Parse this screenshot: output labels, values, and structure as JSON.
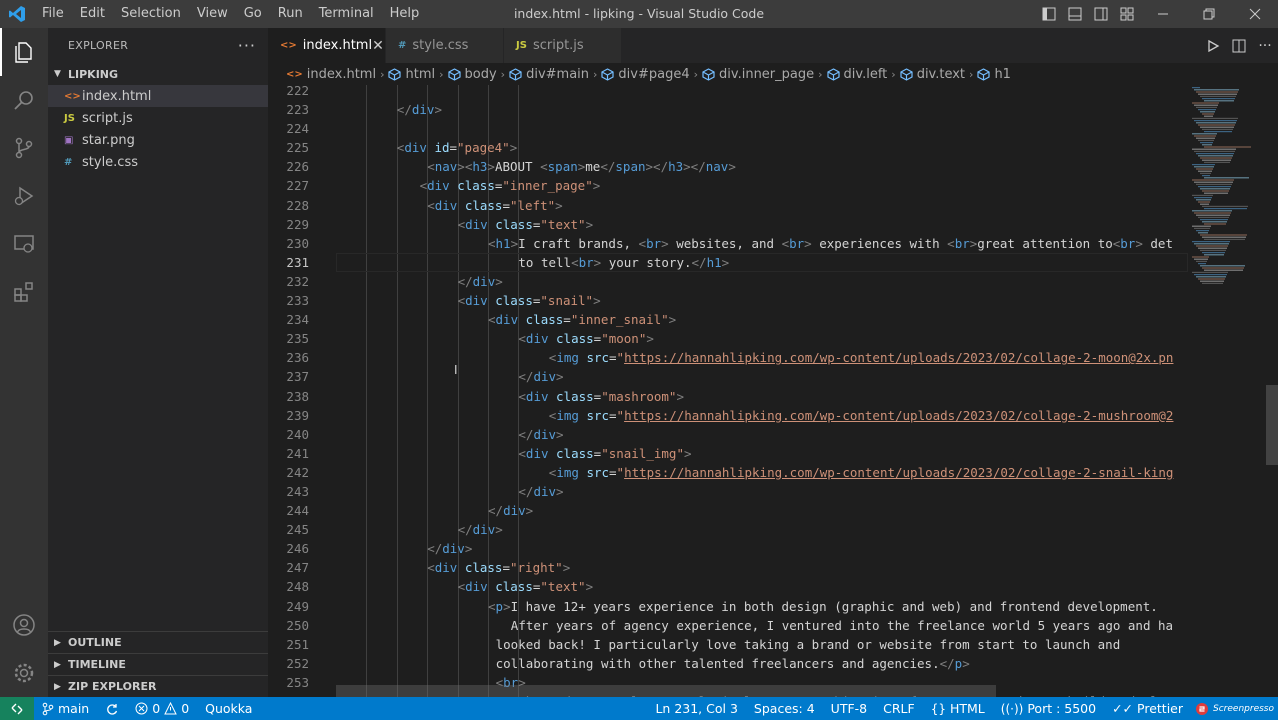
{
  "window": {
    "title": "index.html - lipking - Visual Studio Code",
    "menu": [
      "File",
      "Edit",
      "Selection",
      "View",
      "Go",
      "Run",
      "Terminal",
      "Help"
    ]
  },
  "sidebar": {
    "title": "EXPLORER",
    "folder": "LIPKING",
    "files": [
      {
        "name": "index.html",
        "icon_text": "<>",
        "color": "#e37933",
        "selected": true
      },
      {
        "name": "script.js",
        "icon_text": "JS",
        "color": "#cbcb41",
        "selected": false
      },
      {
        "name": "star.png",
        "icon_text": "▣",
        "color": "#a074c4",
        "selected": false
      },
      {
        "name": "style.css",
        "icon_text": "#",
        "color": "#519aba",
        "selected": false
      }
    ],
    "sections": [
      "OUTLINE",
      "TIMELINE",
      "ZIP EXPLORER"
    ]
  },
  "tabs": [
    {
      "name": "index.html",
      "icon_text": "<>",
      "color": "#e37933",
      "active": true
    },
    {
      "name": "style.css",
      "icon_text": "#",
      "color": "#519aba",
      "active": false
    },
    {
      "name": "script.js",
      "icon_text": "JS",
      "color": "#cbcb41",
      "active": false
    }
  ],
  "breadcrumb": [
    "index.html",
    "html",
    "body",
    "div#main",
    "div#page4",
    "div.inner_page",
    "div.left",
    "div.text",
    "h1"
  ],
  "editor": {
    "current_line": "231",
    "lines": [
      {
        "n": "222",
        "indent": 0,
        "parts": []
      },
      {
        "n": "223",
        "indent": 8,
        "parts": [
          {
            "t": "tb",
            "v": "</"
          },
          {
            "t": "tg",
            "v": "div"
          },
          {
            "t": "tb",
            "v": ">"
          }
        ]
      },
      {
        "n": "224",
        "indent": 0,
        "parts": []
      },
      {
        "n": "225",
        "indent": 8,
        "parts": [
          {
            "t": "tb",
            "v": "<"
          },
          {
            "t": "tg",
            "v": "div"
          },
          {
            "t": "tx",
            "v": " "
          },
          {
            "t": "at",
            "v": "id"
          },
          {
            "t": "tx",
            "v": "="
          },
          {
            "t": "sv",
            "v": "\"page4\""
          },
          {
            "t": "tb",
            "v": ">"
          }
        ]
      },
      {
        "n": "226",
        "indent": 12,
        "parts": [
          {
            "t": "tb",
            "v": "<"
          },
          {
            "t": "tg",
            "v": "nav"
          },
          {
            "t": "tb",
            "v": "><"
          },
          {
            "t": "tg",
            "v": "h3"
          },
          {
            "t": "tb",
            "v": ">"
          },
          {
            "t": "tx",
            "v": "ABOUT "
          },
          {
            "t": "tb",
            "v": "<"
          },
          {
            "t": "tg",
            "v": "span"
          },
          {
            "t": "tb",
            "v": ">"
          },
          {
            "t": "tx",
            "v": "me"
          },
          {
            "t": "tb",
            "v": "</"
          },
          {
            "t": "tg",
            "v": "span"
          },
          {
            "t": "tb",
            "v": "></"
          },
          {
            "t": "tg",
            "v": "h3"
          },
          {
            "t": "tb",
            "v": "></"
          },
          {
            "t": "tg",
            "v": "nav"
          },
          {
            "t": "tb",
            "v": ">"
          }
        ]
      },
      {
        "n": "227",
        "indent": 11,
        "parts": [
          {
            "t": "tb",
            "v": "<"
          },
          {
            "t": "tg",
            "v": "div"
          },
          {
            "t": "tx",
            "v": " "
          },
          {
            "t": "at",
            "v": "class"
          },
          {
            "t": "tx",
            "v": "="
          },
          {
            "t": "sv",
            "v": "\"inner_page\""
          },
          {
            "t": "tb",
            "v": ">"
          }
        ]
      },
      {
        "n": "228",
        "indent": 12,
        "parts": [
          {
            "t": "tb",
            "v": "<"
          },
          {
            "t": "tg",
            "v": "div"
          },
          {
            "t": "tx",
            "v": " "
          },
          {
            "t": "at",
            "v": "class"
          },
          {
            "t": "tx",
            "v": "="
          },
          {
            "t": "sv",
            "v": "\"left\""
          },
          {
            "t": "tb",
            "v": ">"
          }
        ]
      },
      {
        "n": "229",
        "indent": 16,
        "parts": [
          {
            "t": "tb",
            "v": "<"
          },
          {
            "t": "tg",
            "v": "div"
          },
          {
            "t": "tx",
            "v": " "
          },
          {
            "t": "at",
            "v": "class"
          },
          {
            "t": "tx",
            "v": "="
          },
          {
            "t": "sv",
            "v": "\"text\""
          },
          {
            "t": "tb",
            "v": ">"
          }
        ]
      },
      {
        "n": "230",
        "indent": 20,
        "parts": [
          {
            "t": "tb",
            "v": "<"
          },
          {
            "t": "tg",
            "v": "h1"
          },
          {
            "t": "tb",
            "v": ">"
          },
          {
            "t": "tx",
            "v": "I craft brands, "
          },
          {
            "t": "tb",
            "v": "<"
          },
          {
            "t": "tg",
            "v": "br"
          },
          {
            "t": "tb",
            "v": ">"
          },
          {
            "t": "tx",
            "v": " websites, and "
          },
          {
            "t": "tb",
            "v": "<"
          },
          {
            "t": "tg",
            "v": "br"
          },
          {
            "t": "tb",
            "v": ">"
          },
          {
            "t": "tx",
            "v": " experiences with "
          },
          {
            "t": "tb",
            "v": "<"
          },
          {
            "t": "tg",
            "v": "br"
          },
          {
            "t": "tb",
            "v": ">"
          },
          {
            "t": "tx",
            "v": "great attention to"
          },
          {
            "t": "tb",
            "v": "<"
          },
          {
            "t": "tg",
            "v": "br"
          },
          {
            "t": "tb",
            "v": ">"
          },
          {
            "t": "tx",
            "v": " det"
          }
        ]
      },
      {
        "n": "231",
        "indent": 24,
        "parts": [
          {
            "t": "tx",
            "v": "to tell"
          },
          {
            "t": "tb",
            "v": "<"
          },
          {
            "t": "tg",
            "v": "br"
          },
          {
            "t": "tb",
            "v": ">"
          },
          {
            "t": "tx",
            "v": " your story."
          },
          {
            "t": "tb",
            "v": "</"
          },
          {
            "t": "tg",
            "v": "h1"
          },
          {
            "t": "tb",
            "v": ">"
          }
        ]
      },
      {
        "n": "232",
        "indent": 16,
        "parts": [
          {
            "t": "tb",
            "v": "</"
          },
          {
            "t": "tg",
            "v": "div"
          },
          {
            "t": "tb",
            "v": ">"
          }
        ]
      },
      {
        "n": "233",
        "indent": 16,
        "parts": [
          {
            "t": "tb",
            "v": "<"
          },
          {
            "t": "tg",
            "v": "div"
          },
          {
            "t": "tx",
            "v": " "
          },
          {
            "t": "at",
            "v": "class"
          },
          {
            "t": "tx",
            "v": "="
          },
          {
            "t": "sv",
            "v": "\"snail\""
          },
          {
            "t": "tb",
            "v": ">"
          }
        ]
      },
      {
        "n": "234",
        "indent": 20,
        "parts": [
          {
            "t": "tb",
            "v": "<"
          },
          {
            "t": "tg",
            "v": "div"
          },
          {
            "t": "tx",
            "v": " "
          },
          {
            "t": "at",
            "v": "class"
          },
          {
            "t": "tx",
            "v": "="
          },
          {
            "t": "sv",
            "v": "\"inner_snail\""
          },
          {
            "t": "tb",
            "v": ">"
          }
        ]
      },
      {
        "n": "235",
        "indent": 24,
        "parts": [
          {
            "t": "tb",
            "v": "<"
          },
          {
            "t": "tg",
            "v": "div"
          },
          {
            "t": "tx",
            "v": " "
          },
          {
            "t": "at",
            "v": "class"
          },
          {
            "t": "tx",
            "v": "="
          },
          {
            "t": "sv",
            "v": "\"moon\""
          },
          {
            "t": "tb",
            "v": ">"
          }
        ]
      },
      {
        "n": "236",
        "indent": 28,
        "parts": [
          {
            "t": "tb",
            "v": "<"
          },
          {
            "t": "tg",
            "v": "img"
          },
          {
            "t": "tx",
            "v": " "
          },
          {
            "t": "at",
            "v": "src"
          },
          {
            "t": "tx",
            "v": "="
          },
          {
            "t": "sv",
            "v": "\""
          },
          {
            "t": "url",
            "v": "https://hannahlipking.com/wp-content/uploads/2023/02/collage-2-moon@2x.pn"
          }
        ]
      },
      {
        "n": "237",
        "indent": 24,
        "parts": [
          {
            "t": "tb",
            "v": "</"
          },
          {
            "t": "tg",
            "v": "div"
          },
          {
            "t": "tb",
            "v": ">"
          }
        ]
      },
      {
        "n": "238",
        "indent": 24,
        "parts": [
          {
            "t": "tb",
            "v": "<"
          },
          {
            "t": "tg",
            "v": "div"
          },
          {
            "t": "tx",
            "v": " "
          },
          {
            "t": "at",
            "v": "class"
          },
          {
            "t": "tx",
            "v": "="
          },
          {
            "t": "sv",
            "v": "\"mashroom\""
          },
          {
            "t": "tb",
            "v": ">"
          }
        ]
      },
      {
        "n": "239",
        "indent": 28,
        "parts": [
          {
            "t": "tb",
            "v": "<"
          },
          {
            "t": "tg",
            "v": "img"
          },
          {
            "t": "tx",
            "v": " "
          },
          {
            "t": "at",
            "v": "src"
          },
          {
            "t": "tx",
            "v": "="
          },
          {
            "t": "sv",
            "v": "\""
          },
          {
            "t": "url",
            "v": "https://hannahlipking.com/wp-content/uploads/2023/02/collage-2-mushroom@2"
          }
        ]
      },
      {
        "n": "240",
        "indent": 24,
        "parts": [
          {
            "t": "tb",
            "v": "</"
          },
          {
            "t": "tg",
            "v": "div"
          },
          {
            "t": "tb",
            "v": ">"
          }
        ]
      },
      {
        "n": "241",
        "indent": 24,
        "parts": [
          {
            "t": "tb",
            "v": "<"
          },
          {
            "t": "tg",
            "v": "div"
          },
          {
            "t": "tx",
            "v": " "
          },
          {
            "t": "at",
            "v": "class"
          },
          {
            "t": "tx",
            "v": "="
          },
          {
            "t": "sv",
            "v": "\"snail_img\""
          },
          {
            "t": "tb",
            "v": ">"
          }
        ]
      },
      {
        "n": "242",
        "indent": 28,
        "parts": [
          {
            "t": "tb",
            "v": "<"
          },
          {
            "t": "tg",
            "v": "img"
          },
          {
            "t": "tx",
            "v": " "
          },
          {
            "t": "at",
            "v": "src"
          },
          {
            "t": "tx",
            "v": "="
          },
          {
            "t": "sv",
            "v": "\""
          },
          {
            "t": "url",
            "v": "https://hannahlipking.com/wp-content/uploads/2023/02/collage-2-snail-king"
          }
        ]
      },
      {
        "n": "243",
        "indent": 24,
        "parts": [
          {
            "t": "tb",
            "v": "</"
          },
          {
            "t": "tg",
            "v": "div"
          },
          {
            "t": "tb",
            "v": ">"
          }
        ]
      },
      {
        "n": "244",
        "indent": 20,
        "parts": [
          {
            "t": "tb",
            "v": "</"
          },
          {
            "t": "tg",
            "v": "div"
          },
          {
            "t": "tb",
            "v": ">"
          }
        ]
      },
      {
        "n": "245",
        "indent": 16,
        "parts": [
          {
            "t": "tb",
            "v": "</"
          },
          {
            "t": "tg",
            "v": "div"
          },
          {
            "t": "tb",
            "v": ">"
          }
        ]
      },
      {
        "n": "246",
        "indent": 12,
        "parts": [
          {
            "t": "tb",
            "v": "</"
          },
          {
            "t": "tg",
            "v": "div"
          },
          {
            "t": "tb",
            "v": ">"
          }
        ]
      },
      {
        "n": "247",
        "indent": 12,
        "parts": [
          {
            "t": "tb",
            "v": "<"
          },
          {
            "t": "tg",
            "v": "div"
          },
          {
            "t": "tx",
            "v": " "
          },
          {
            "t": "at",
            "v": "class"
          },
          {
            "t": "tx",
            "v": "="
          },
          {
            "t": "sv",
            "v": "\"right\""
          },
          {
            "t": "tb",
            "v": ">"
          }
        ]
      },
      {
        "n": "248",
        "indent": 16,
        "parts": [
          {
            "t": "tb",
            "v": "<"
          },
          {
            "t": "tg",
            "v": "div"
          },
          {
            "t": "tx",
            "v": " "
          },
          {
            "t": "at",
            "v": "class"
          },
          {
            "t": "tx",
            "v": "="
          },
          {
            "t": "sv",
            "v": "\"text\""
          },
          {
            "t": "tb",
            "v": ">"
          }
        ]
      },
      {
        "n": "249",
        "indent": 20,
        "parts": [
          {
            "t": "tb",
            "v": "<"
          },
          {
            "t": "tg",
            "v": "p"
          },
          {
            "t": "tb",
            "v": ">"
          },
          {
            "t": "tx",
            "v": "I have 12+ years experience in both design (graphic and web) and frontend development."
          }
        ]
      },
      {
        "n": "250",
        "indent": 23,
        "parts": [
          {
            "t": "tx",
            "v": "After years of agency experience, I ventured into the freelance world 5 years ago and ha"
          }
        ]
      },
      {
        "n": "251",
        "indent": 21,
        "parts": [
          {
            "t": "tx",
            "v": "looked back! I particularly love taking a brand or website from start to launch and"
          }
        ]
      },
      {
        "n": "252",
        "indent": 21,
        "parts": [
          {
            "t": "tx",
            "v": "collaborating with other talented freelancers and agencies."
          },
          {
            "t": "tb",
            "v": "</"
          },
          {
            "t": "tg",
            "v": "p"
          },
          {
            "t": "tb",
            "v": ">"
          }
        ]
      },
      {
        "n": "253",
        "indent": 21,
        "parts": [
          {
            "t": "tb",
            "v": "<"
          },
          {
            "t": "tg",
            "v": "br"
          },
          {
            "t": "tb",
            "v": ">"
          }
        ]
      },
      {
        "n": "254",
        "indent": 21,
        "parts": [
          {
            "t": "tb",
            "v": "<"
          },
          {
            "t": "tg",
            "v": "p"
          },
          {
            "t": "tb",
            "v": ">"
          },
          {
            "t": "tx",
            "v": "These days, I almost exclusively use a combination of a custom WordPress build and Ele"
          }
        ]
      }
    ]
  },
  "statusbar": {
    "branch": "main",
    "errors": "0",
    "warnings": "0",
    "quokka": "Quokka",
    "position": "Ln 231, Col 3",
    "spaces": "Spaces: 4",
    "encoding": "UTF-8",
    "eol": "CRLF",
    "language": "HTML",
    "port": "Port : 5500",
    "prettier": "Prettier",
    "watermark": "Screenpresso"
  }
}
